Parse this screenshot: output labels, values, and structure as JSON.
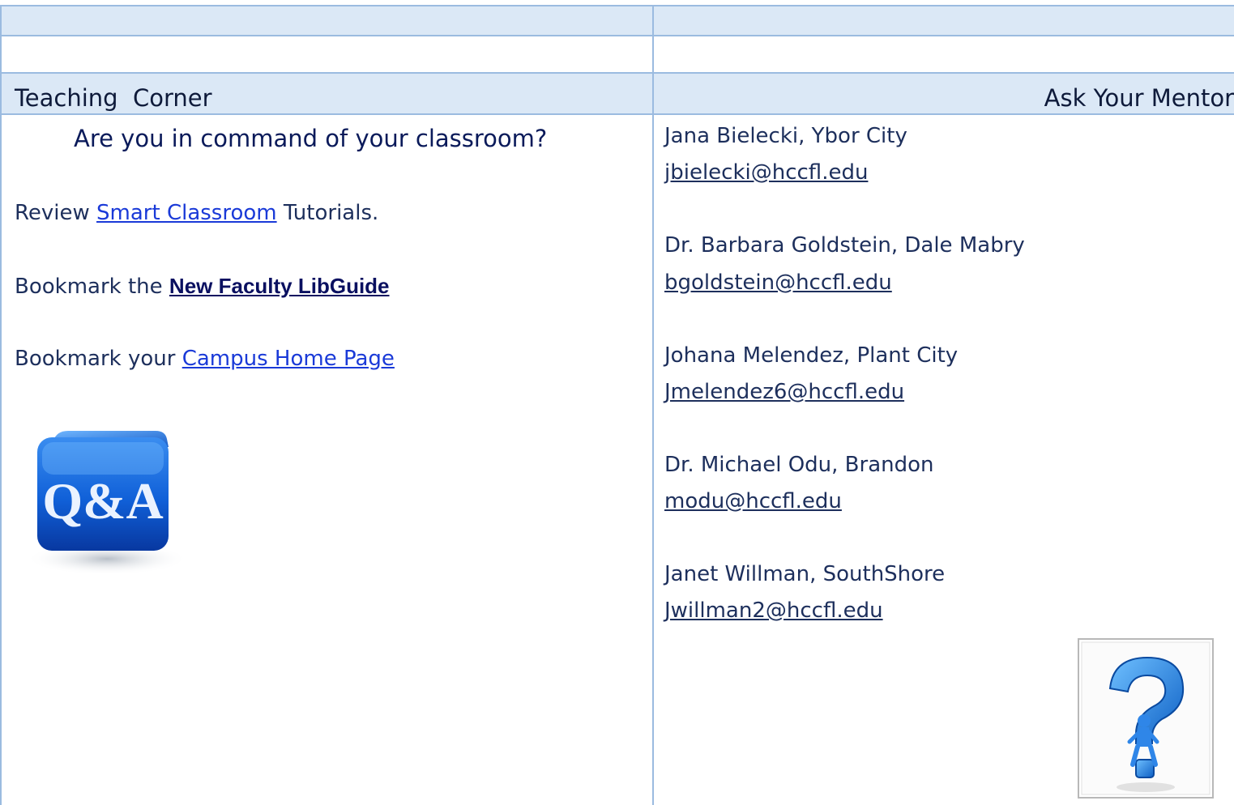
{
  "header": {
    "left_title": "Teaching  Corner",
    "right_title": "Ask Your Mentor"
  },
  "left": {
    "question": "Are you in command of your classroom?",
    "line1": {
      "prefix": "Review ",
      "link": "Smart Classroom",
      "suffix": " Tutorials."
    },
    "line2": {
      "prefix": "Bookmark the ",
      "link": "New Faculty LibGuide"
    },
    "line3": {
      "prefix": "Bookmark your ",
      "link": "Campus Home Page"
    },
    "qa_image": {
      "icon": "qa-cube-icon",
      "text": "Q&A"
    }
  },
  "mentors": [
    {
      "name": "Jana Bielecki, Ybor City",
      "email": "jbielecki@hccfl.edu"
    },
    {
      "name": "Dr. Barbara Goldstein, Dale Mabry",
      "email": "bgoldstein@hccfl.edu"
    },
    {
      "name": "Johana Melendez, Plant City",
      "email": "Jmelendez6@hccfl.edu"
    },
    {
      "name": "Dr. Michael Odu, Brandon",
      "email": "modu@hccfl.edu"
    },
    {
      "name": "Janet Willman, SouthShore",
      "email": "Jwillman2@hccfl.edu"
    }
  ],
  "question_image": {
    "icon": "question-mark-figure-icon"
  },
  "colors": {
    "band": "#dbe8f6",
    "grid_line": "#9bbbe0",
    "link": "#1a3ad8"
  }
}
